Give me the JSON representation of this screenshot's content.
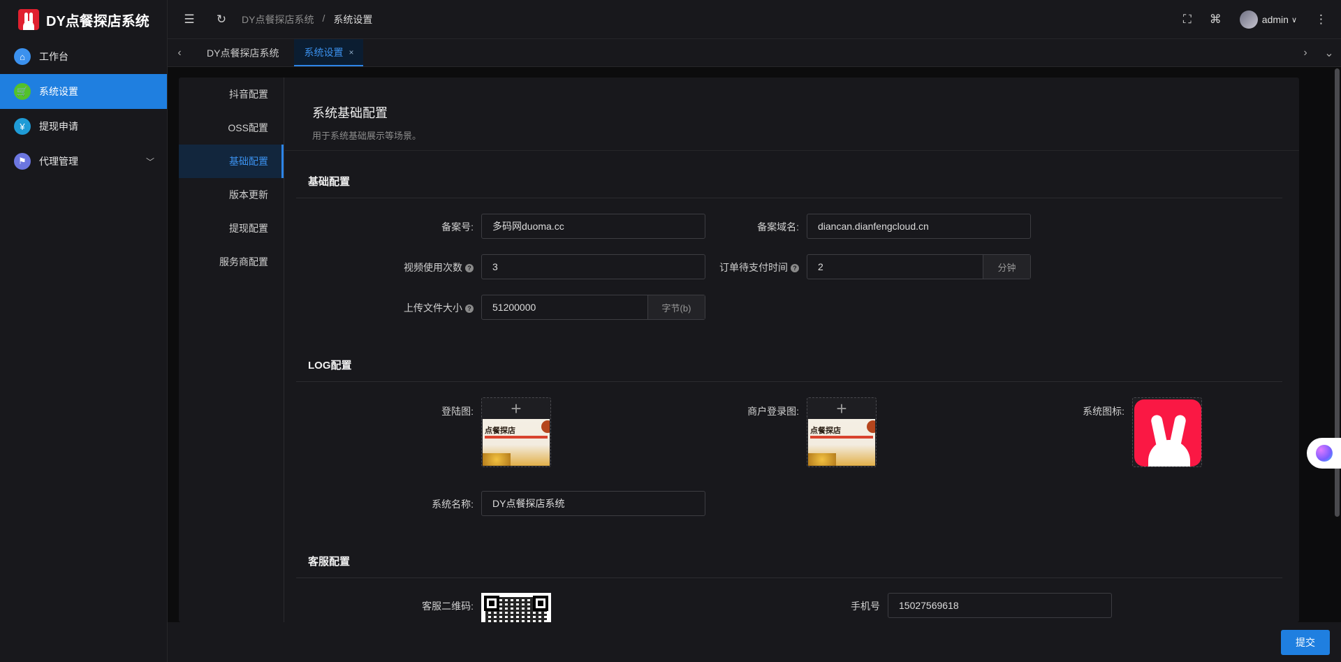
{
  "app": {
    "title": "DY点餐探店系统",
    "accent_color": "#1f7fe0",
    "brand_color": "#e0202f"
  },
  "sidebar": {
    "items": [
      {
        "label": "工作台",
        "icon": "home-icon",
        "icon_color": "#3b91ee"
      },
      {
        "label": "系统设置",
        "icon": "cart-icon",
        "icon_color": "#53c22b"
      },
      {
        "label": "提现申请",
        "icon": "yen-icon",
        "icon_color": "#1f9bd6"
      },
      {
        "label": "代理管理",
        "icon": "flag-icon",
        "icon_color": "#6c76e0"
      }
    ]
  },
  "topbar": {
    "breadcrumb": [
      "DY点餐探店系统",
      "/",
      "系统设置"
    ],
    "user": "admin"
  },
  "tabs": [
    {
      "label": "DY点餐探店系统"
    },
    {
      "label": "系统设置",
      "close": "×"
    }
  ],
  "subnav": [
    "抖音配置",
    "OSS配置",
    "基础配置",
    "版本更新",
    "提现配置",
    "服务商配置"
  ],
  "page": {
    "title": "系统基础配置",
    "desc": "用于系统基础展示等场景。"
  },
  "sections": {
    "basic": {
      "title": "基础配置",
      "record_no_label": "备案号:",
      "record_no_value": "多码网duoma.cc",
      "record_domain_label": "备案域名:",
      "record_domain_value": "diancan.dianfengcloud.cn",
      "video_count_label": "视频使用次数",
      "video_count_value": "3",
      "order_wait_label": "订单待支付时间",
      "order_wait_value": "2",
      "order_wait_unit": "分钟",
      "upload_size_label": "上传文件大小",
      "upload_size_value": "51200000",
      "upload_size_unit": "字节(b)",
      "help_mark": "?"
    },
    "log": {
      "title": "LOG配置",
      "login_img_label": "登陆图:",
      "merchant_img_label": "商户登录图:",
      "sys_icon_label": "系统图标:",
      "thumb_text": "点餐探店",
      "sys_name_label": "系统名称:",
      "sys_name_value": "DY点餐探店系统"
    },
    "service": {
      "title": "客服配置",
      "qr_label": "客服二维码:",
      "phone_label": "手机号",
      "phone_value": "15027569618"
    }
  },
  "footer": {
    "submit": "提交"
  }
}
